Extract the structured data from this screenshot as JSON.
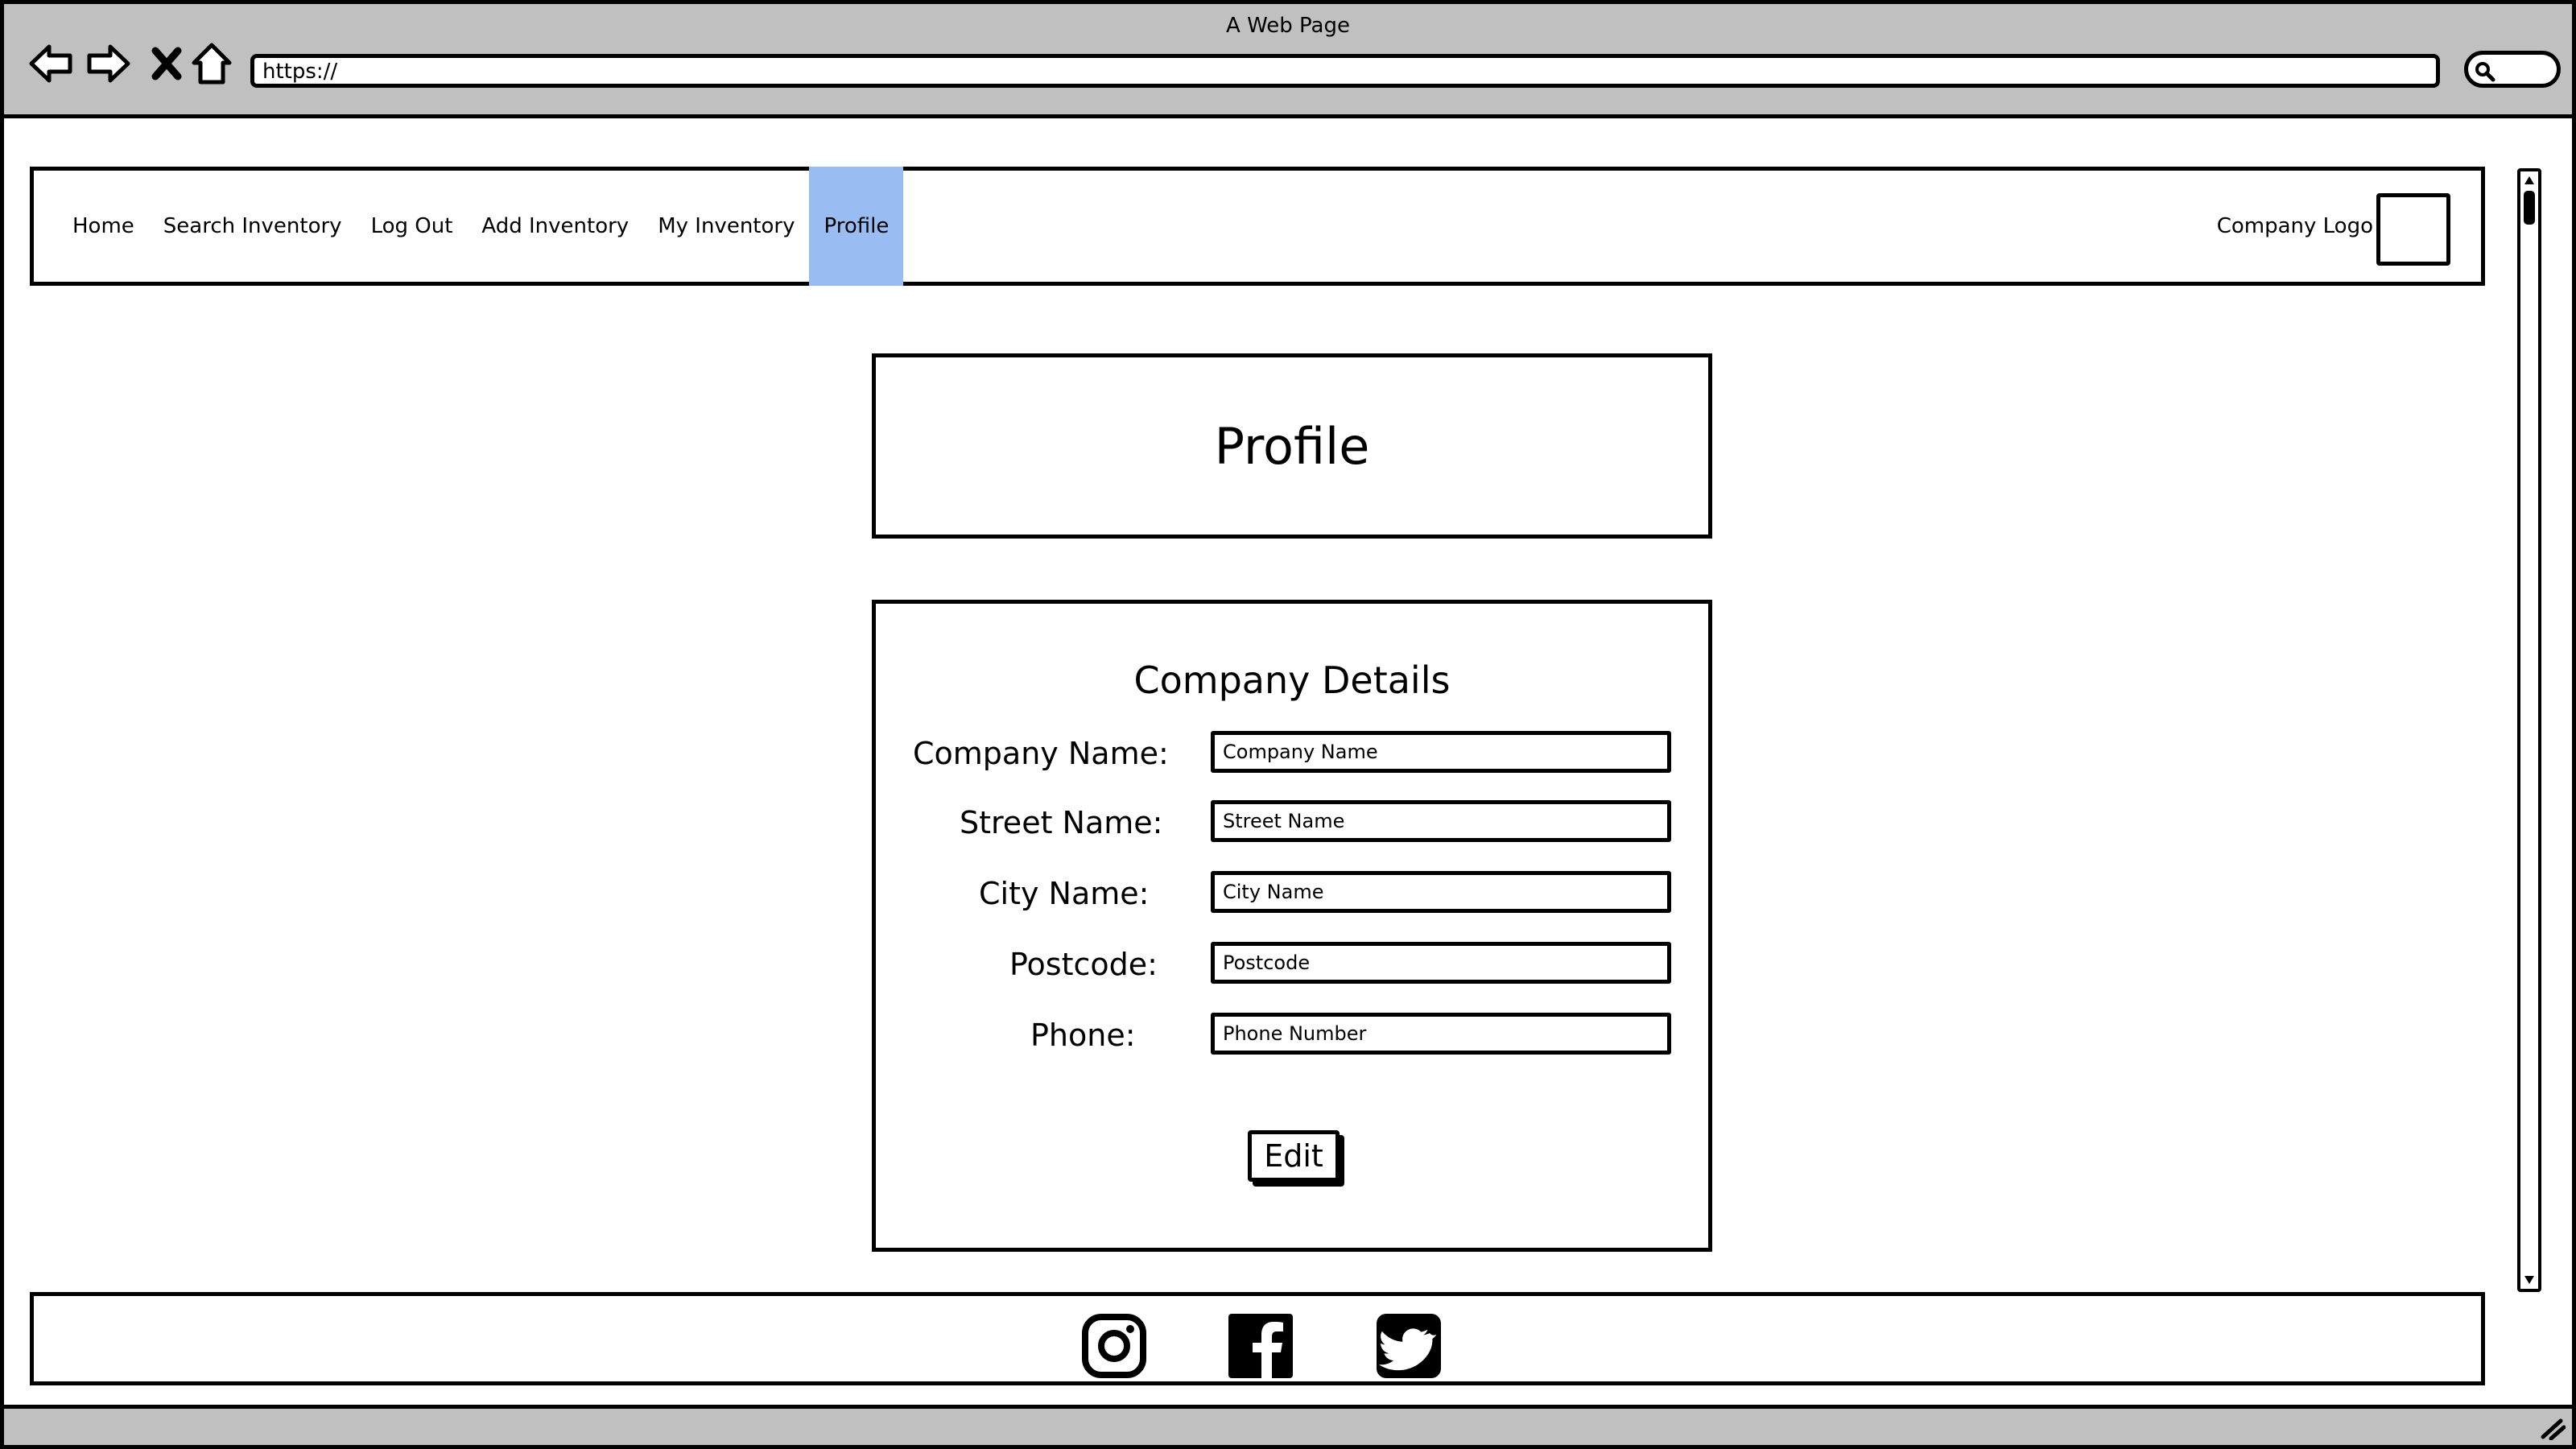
{
  "window": {
    "title": "A Web Page",
    "url": "https://"
  },
  "icons": {
    "back": "back-arrow-icon",
    "forward": "forward-arrow-icon",
    "stop": "close-icon",
    "home": "home-icon",
    "search": "search-icon"
  },
  "nav": {
    "items": [
      {
        "label": "Home"
      },
      {
        "label": "Search Inventory"
      },
      {
        "label": "Log Out"
      },
      {
        "label": "Add Inventory"
      },
      {
        "label": "My Inventory"
      },
      {
        "label": "Profile",
        "active": true
      }
    ],
    "active_color": "#99bdf2",
    "company_logo_label": "Company Logo"
  },
  "page": {
    "title": "Profile"
  },
  "form": {
    "heading": "Company Details",
    "fields": [
      {
        "label": "Company Name:",
        "placeholder": "Company Name",
        "value": ""
      },
      {
        "label": "Street Name:",
        "placeholder": "Street Name",
        "value": ""
      },
      {
        "label": "City Name:",
        "placeholder": "City Name",
        "value": ""
      },
      {
        "label": "Postcode:",
        "placeholder": "Postcode",
        "value": ""
      },
      {
        "label": "Phone:",
        "placeholder": "Phone Number",
        "value": ""
      }
    ],
    "edit_label": "Edit"
  },
  "footer": {
    "social": [
      "instagram-icon",
      "facebook-icon",
      "twitter-icon"
    ]
  }
}
